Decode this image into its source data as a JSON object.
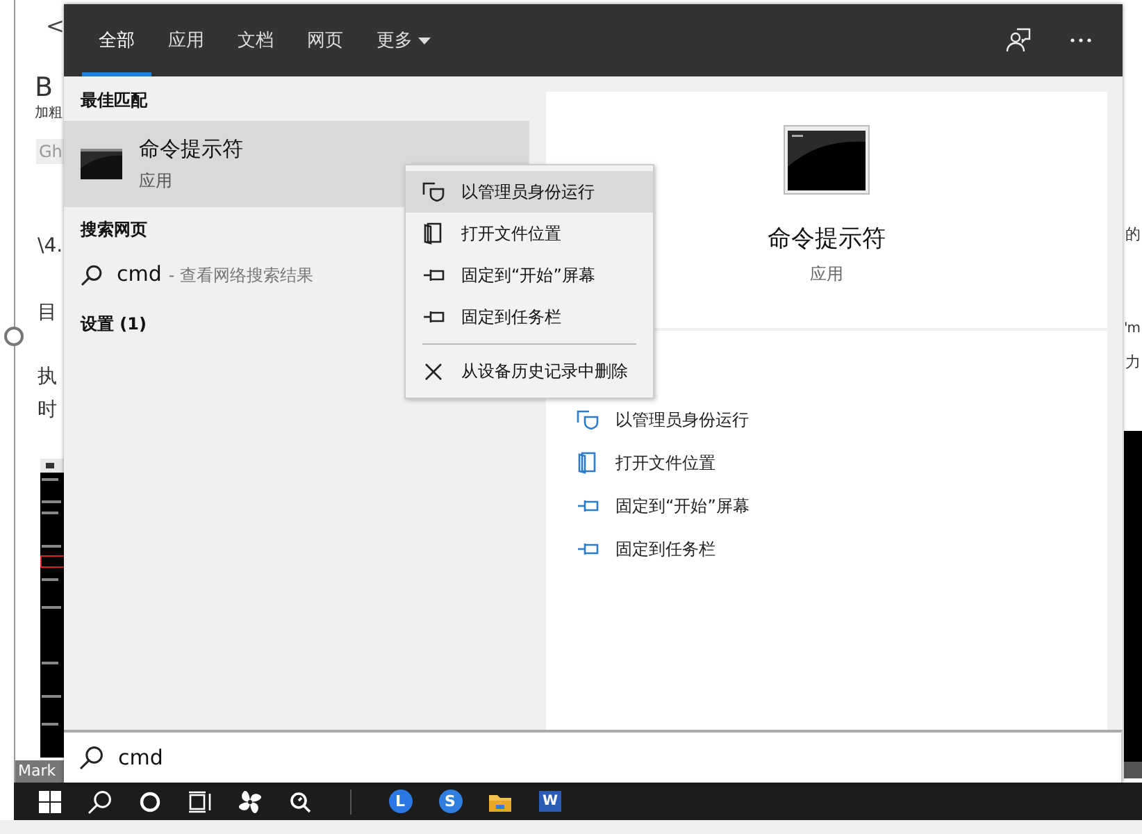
{
  "document": {
    "back": "<",
    "bold_button": {
      "glyph": "B",
      "label": "加粗"
    },
    "fragments": [
      "Gh",
      "\\4.",
      "目",
      "执",
      "时",
      "的",
      "'m",
      "力"
    ],
    "status_label": "Mark"
  },
  "search_panel": {
    "tabs": [
      {
        "label": "全部",
        "selected": true,
        "has_menu": false
      },
      {
        "label": "应用",
        "selected": false,
        "has_menu": false
      },
      {
        "label": "文档",
        "selected": false,
        "has_menu": false
      },
      {
        "label": "网页",
        "selected": false,
        "has_menu": false
      },
      {
        "label": "更多",
        "selected": false,
        "has_menu": true
      }
    ],
    "best_match": {
      "heading": "最佳匹配",
      "title": "命令提示符",
      "subtitle": "应用",
      "selected": true
    },
    "web": {
      "heading": "搜索网页",
      "query": "cmd",
      "hint": "- 查看网络搜索结果"
    },
    "settings": {
      "heading": "设置 (1)"
    },
    "preview": {
      "title": "命令提示符",
      "subtitle": "应用",
      "actions": [
        {
          "label": "以管理员身份运行",
          "kind": "shield"
        },
        {
          "label": "打开文件位置",
          "kind": "folder"
        },
        {
          "label": "固定到“开始”屏幕",
          "kind": "pin"
        },
        {
          "label": "固定到任务栏",
          "kind": "pin"
        }
      ]
    },
    "search_box": {
      "value": "cmd"
    }
  },
  "context_menu": {
    "items": [
      {
        "label": "以管理员身份运行",
        "kind": "shield",
        "selected": true,
        "separator_before": false
      },
      {
        "label": "打开文件位置",
        "kind": "folder",
        "selected": false,
        "separator_before": false
      },
      {
        "label": "固定到“开始”屏幕",
        "kind": "pin",
        "selected": false,
        "separator_before": false
      },
      {
        "label": "固定到任务栏",
        "kind": "pin",
        "selected": false,
        "separator_before": false
      },
      {
        "label": "从设备历史记录中删除",
        "kind": "close",
        "selected": false,
        "separator_before": true
      }
    ]
  },
  "taskbar": {
    "items": [
      {
        "kind": "start"
      },
      {
        "kind": "search"
      },
      {
        "kind": "cortana"
      },
      {
        "kind": "taskview"
      },
      {
        "kind": "fan"
      },
      {
        "kind": "magnifier"
      },
      {
        "kind": "divider"
      },
      {
        "kind": "app",
        "glyph": "L",
        "color": "#2b78e4"
      },
      {
        "kind": "app",
        "glyph": "S",
        "color": "#2f7fe0"
      },
      {
        "kind": "folder"
      },
      {
        "kind": "word",
        "glyph": "W"
      }
    ]
  }
}
